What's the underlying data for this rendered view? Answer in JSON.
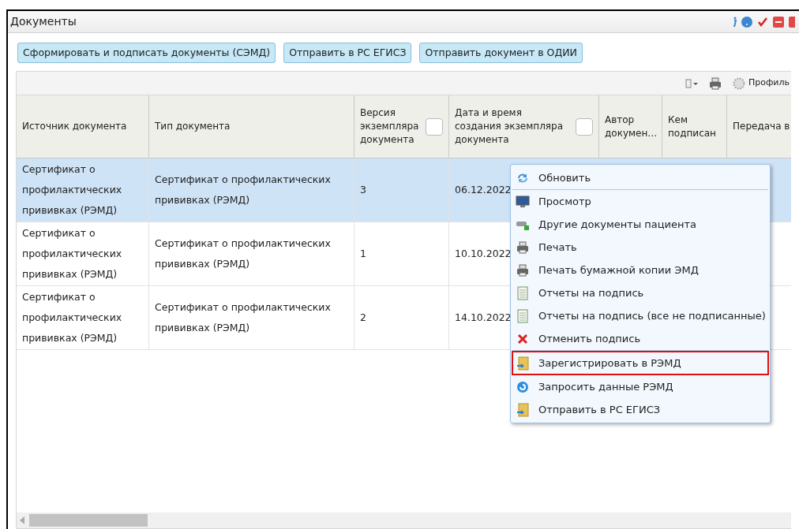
{
  "window": {
    "title": "Документы"
  },
  "actions": [
    "Сформировать и подписать документы (СЭМД)",
    "Отправить в РС ЕГИСЗ",
    "Отправить документ в ОДИИ"
  ],
  "toolbar": {
    "profile": "Профиль"
  },
  "table": {
    "columns": [
      {
        "label": "Источник документа"
      },
      {
        "label": "Тип документа"
      },
      {
        "label": "Версия экземпляра документа",
        "checkbox": {
          "checked": false
        }
      },
      {
        "label": "Дата и время создания экземпляра документа",
        "checkbox": {
          "checked": false
        }
      },
      {
        "label": "Автор докумен…"
      },
      {
        "label": "Кем подписан"
      },
      {
        "label": "Передача в"
      }
    ],
    "rows": [
      {
        "selected": true,
        "cells": [
          "Сертификат о профилактических прививках (РЭМД)",
          "Сертификат о профилактических прививках (РЭМД)",
          "3",
          "06.12.2022"
        ]
      },
      {
        "selected": false,
        "cells": [
          "Сертификат о профилактических прививках (РЭМД)",
          "Сертификат о профилактических прививках (РЭМД)",
          "1",
          "10.10.2022"
        ]
      },
      {
        "selected": false,
        "cells": [
          "Сертификат о профилактических прививках (РЭМД)",
          "Сертификат о профилактических прививках (РЭМД)",
          "2",
          "14.10.2022"
        ]
      }
    ]
  },
  "context_menu": {
    "items": [
      {
        "label": "Обновить",
        "highlighted": false,
        "separator_after": true
      },
      {
        "label": "Просмотр",
        "highlighted": false,
        "separator_after": false
      },
      {
        "label": "Другие документы пациента",
        "highlighted": false,
        "separator_after": false
      },
      {
        "label": "Печать",
        "highlighted": false,
        "separator_after": false
      },
      {
        "label": "Печать бумажной копии ЭМД",
        "highlighted": false,
        "separator_after": false
      },
      {
        "label": "Отчеты на подпись",
        "highlighted": false,
        "separator_after": false
      },
      {
        "label": "Отчеты на подпись (все не подписанные)",
        "highlighted": false,
        "separator_after": false
      },
      {
        "label": "Отменить подпись",
        "highlighted": false,
        "separator_after": true
      },
      {
        "label": "Зарегистрировать в РЭМД",
        "highlighted": true,
        "separator_after": false
      },
      {
        "label": "Запросить данные РЭМД",
        "highlighted": false,
        "separator_after": false
      },
      {
        "label": "Отправить в РС ЕГИСЗ",
        "highlighted": false,
        "separator_after": false
      }
    ]
  }
}
